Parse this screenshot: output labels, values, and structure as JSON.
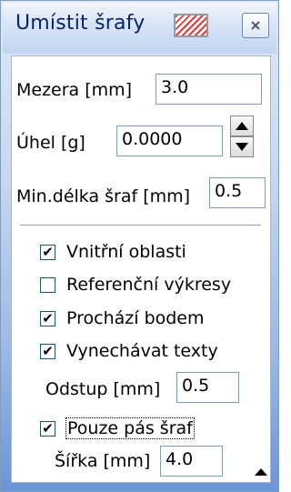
{
  "window": {
    "title": "Umístit šrafy",
    "close_glyph": "×",
    "hatch_icon": "hatch-pattern-icon"
  },
  "fields": {
    "gap": {
      "label": "Mezera [mm]",
      "value": "3.0"
    },
    "angle": {
      "label": "Úhel [g]",
      "value": "0.0000",
      "up_glyph": "▲",
      "down_glyph": "▼"
    },
    "min_length": {
      "label": "Min.délka šraf [mm]",
      "value": "0.5"
    }
  },
  "options": {
    "inner_areas": {
      "label": "Vnitřní oblasti",
      "checked": true,
      "check": "✔"
    },
    "reference_drawings": {
      "label": "Referenční výkresy",
      "checked": false,
      "check": ""
    },
    "through_point": {
      "label": "Prochází bodem",
      "checked": true,
      "check": "✔"
    },
    "skip_texts": {
      "label": "Vynechávat texty",
      "checked": true,
      "check": "✔"
    },
    "only_strip": {
      "label": "Pouze pás šraf",
      "checked": true,
      "check": "✔"
    }
  },
  "sub_fields": {
    "offset": {
      "label": "Odstup [mm]",
      "value": "0.5"
    },
    "width": {
      "label": "Šířka [mm]",
      "value": "4.0"
    }
  },
  "colors": {
    "accent": "#0a246a",
    "field_border": "#7f9db9",
    "hatch": "#e23a3a"
  }
}
